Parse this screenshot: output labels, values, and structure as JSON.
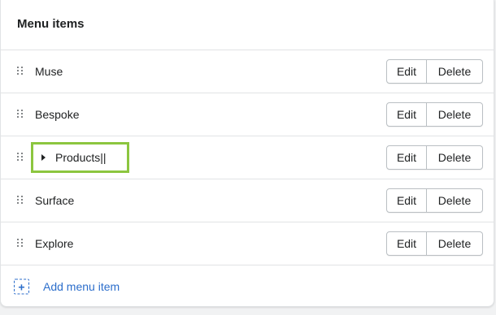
{
  "card": {
    "title": "Menu items"
  },
  "menu_items": [
    {
      "label": "Muse",
      "edit_label": "Edit",
      "delete_label": "Delete"
    },
    {
      "label": "Bespoke",
      "edit_label": "Edit",
      "delete_label": "Delete"
    },
    {
      "label": "Products||",
      "edit_label": "Edit",
      "delete_label": "Delete",
      "expandable": true,
      "highlight_color": "#8cc63f"
    },
    {
      "label": "Surface",
      "edit_label": "Edit",
      "delete_label": "Delete"
    },
    {
      "label": "Explore",
      "edit_label": "Edit",
      "delete_label": "Delete"
    }
  ],
  "add_item": {
    "label": "Add menu item",
    "icon": "add-dashed-square-icon"
  },
  "colors": {
    "link": "#2c6ecb",
    "highlight": "#8cc63f",
    "border": "#e1e3e5"
  }
}
